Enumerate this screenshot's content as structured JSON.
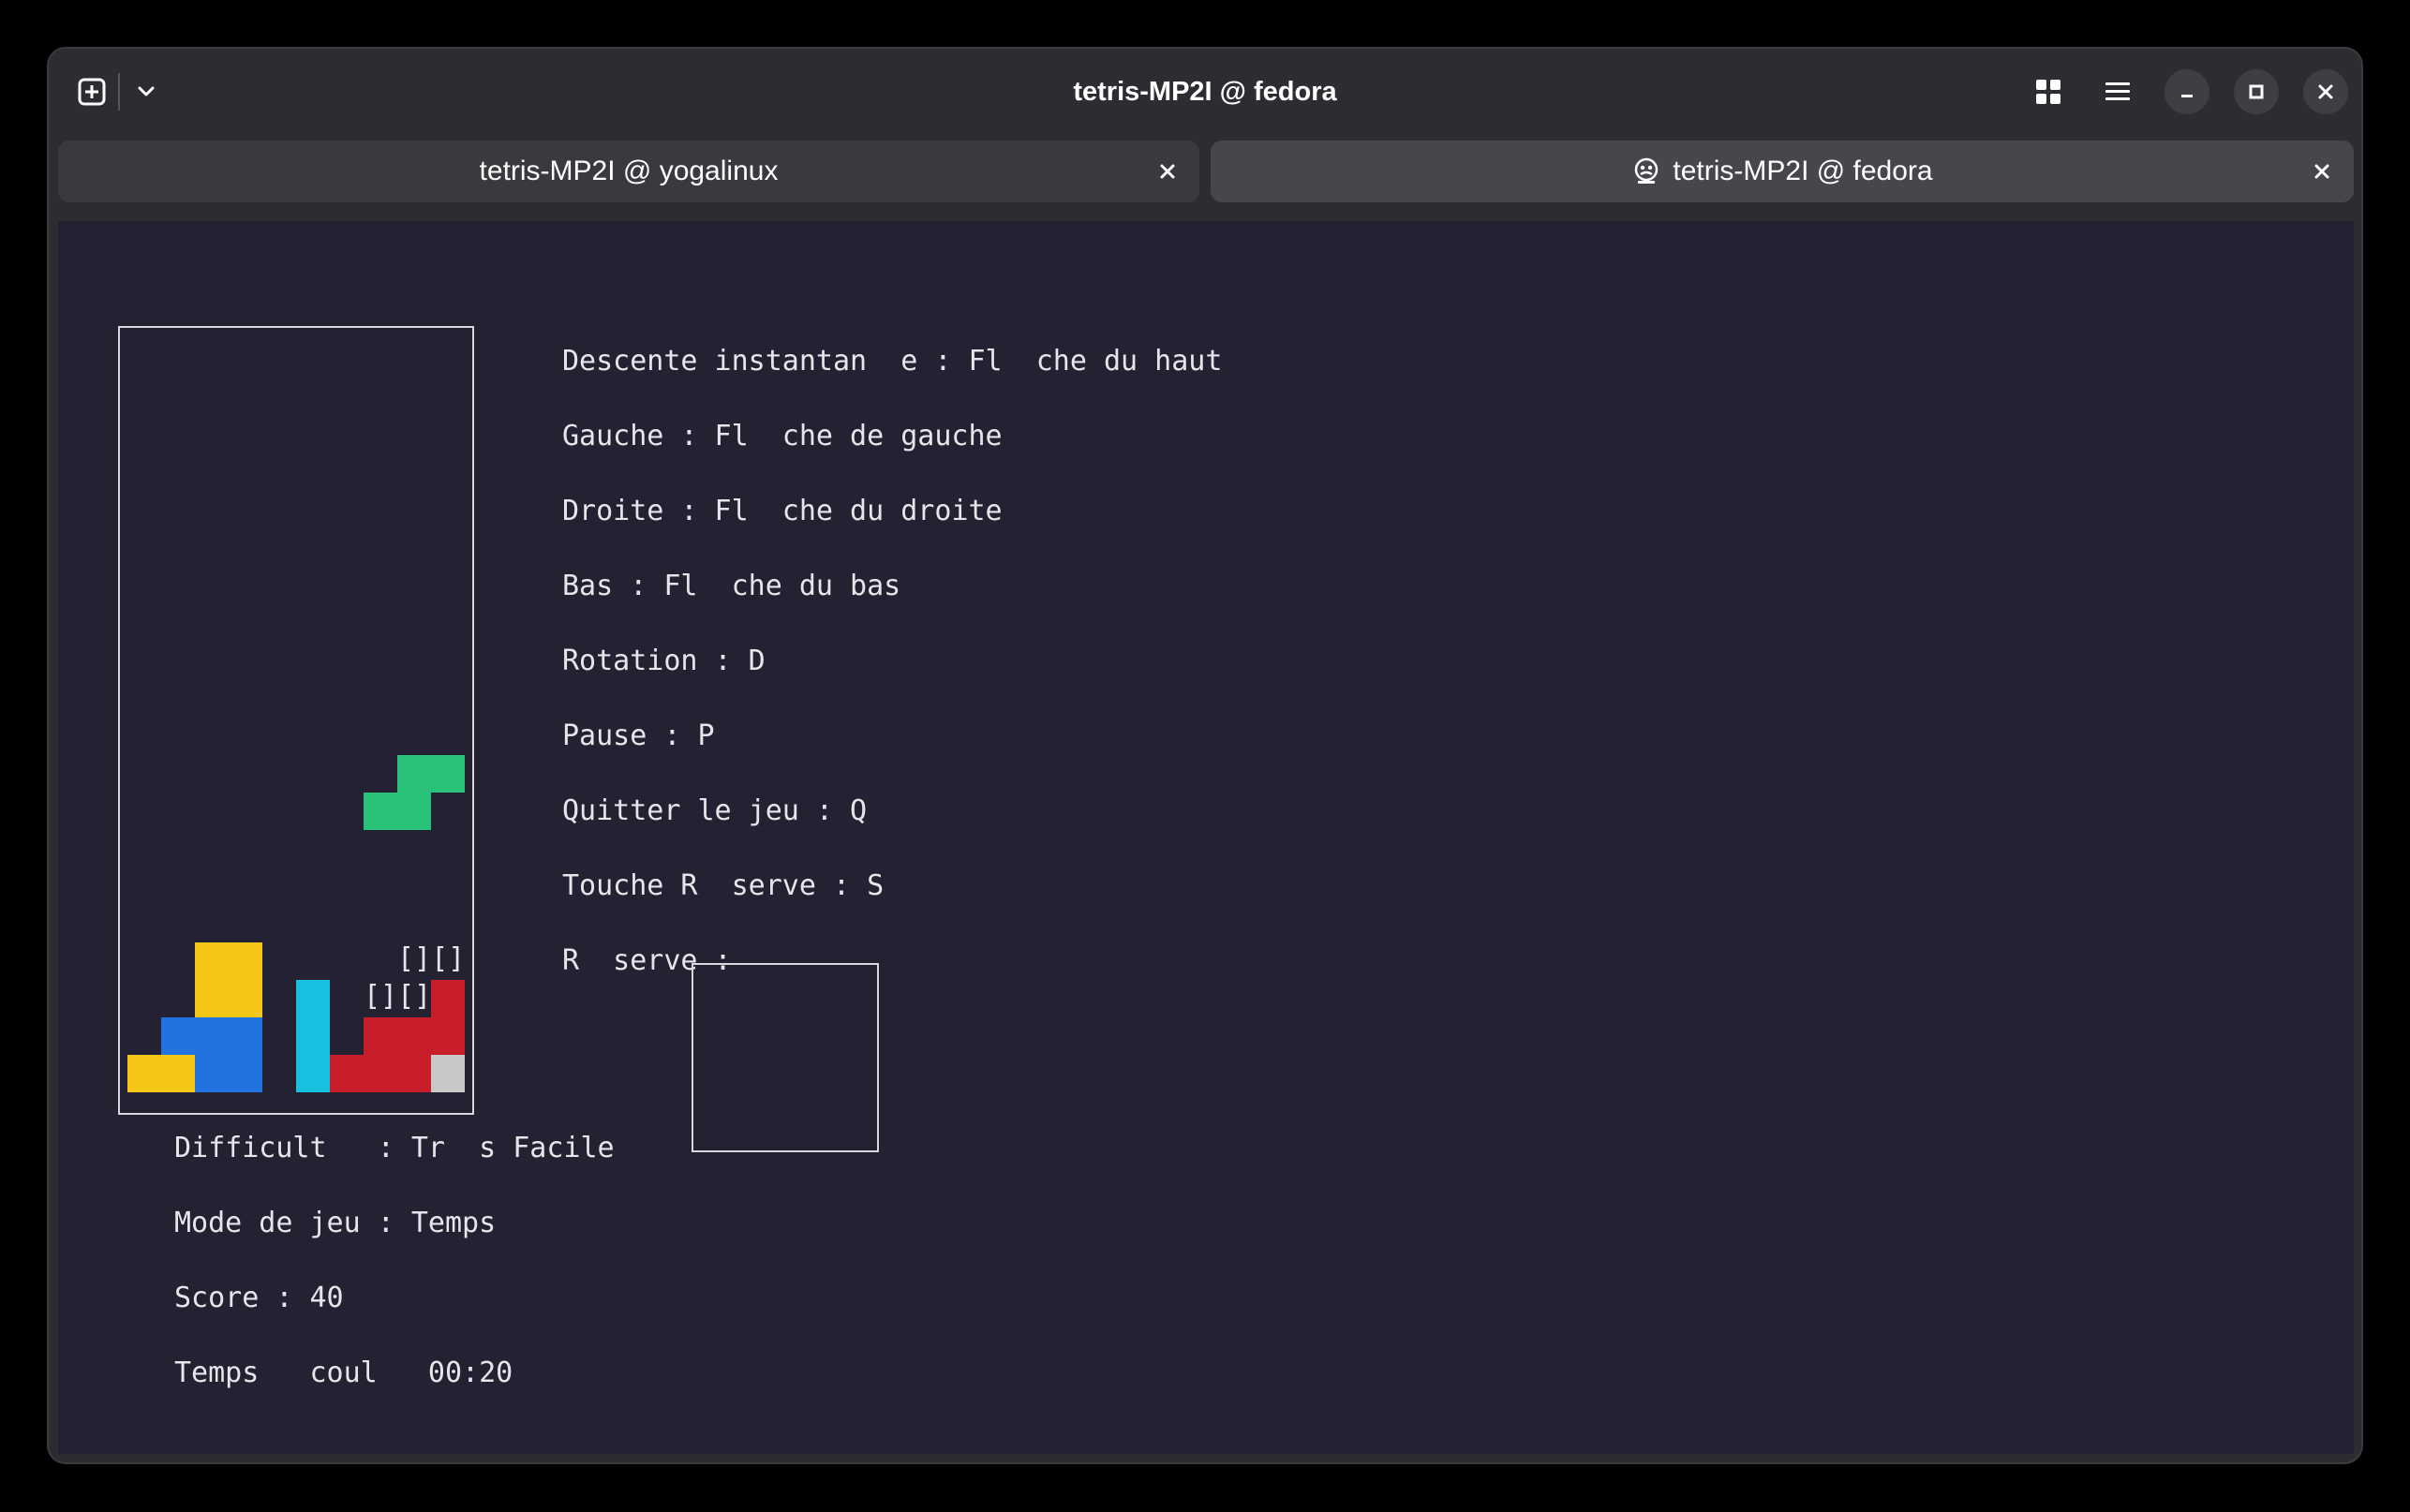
{
  "window": {
    "title": "tetris-MP2I @ fedora"
  },
  "tabs": [
    {
      "label": "tetris-MP2I @ yogalinux",
      "active": false
    },
    {
      "label": "tetris-MP2I @ fedora",
      "active": true
    }
  ],
  "controls": [
    "Descente instantan  e : Fl  che du haut",
    "Gauche : Fl  che de gauche",
    "Droite : Fl  che du droite",
    "Bas : Fl  che du bas",
    "Rotation : D",
    "Pause : P",
    "Quitter le jeu : Q",
    "Touche R  serve : S"
  ],
  "reserve_label": "R  serve :",
  "ghost_piece": {
    "row1": "[][]",
    "row2": "[][]"
  },
  "status": {
    "difficulty": "Difficult   : Tr  s Facile",
    "mode": "Mode de jeu : Temps",
    "score": "Score : 40",
    "time": "Temps   coul   00:20"
  },
  "colors": {
    "yellow": "#f5c518",
    "blue": "#2272e0",
    "cyan": "#18c0e0",
    "red": "#c81e2a",
    "green": "#2ac27a",
    "grey": "#c8c8c8",
    "terminal_bg": "#242133"
  },
  "icons": {
    "new_tab": "plus-square-icon",
    "menu_dropdown": "chevron-down-icon",
    "tab_overview": "grid-icon",
    "main_menu": "hamburger-icon",
    "minimize": "minimize-icon",
    "maximize": "maximize-icon",
    "close": "close-icon",
    "remote": "remote-host-icon"
  }
}
